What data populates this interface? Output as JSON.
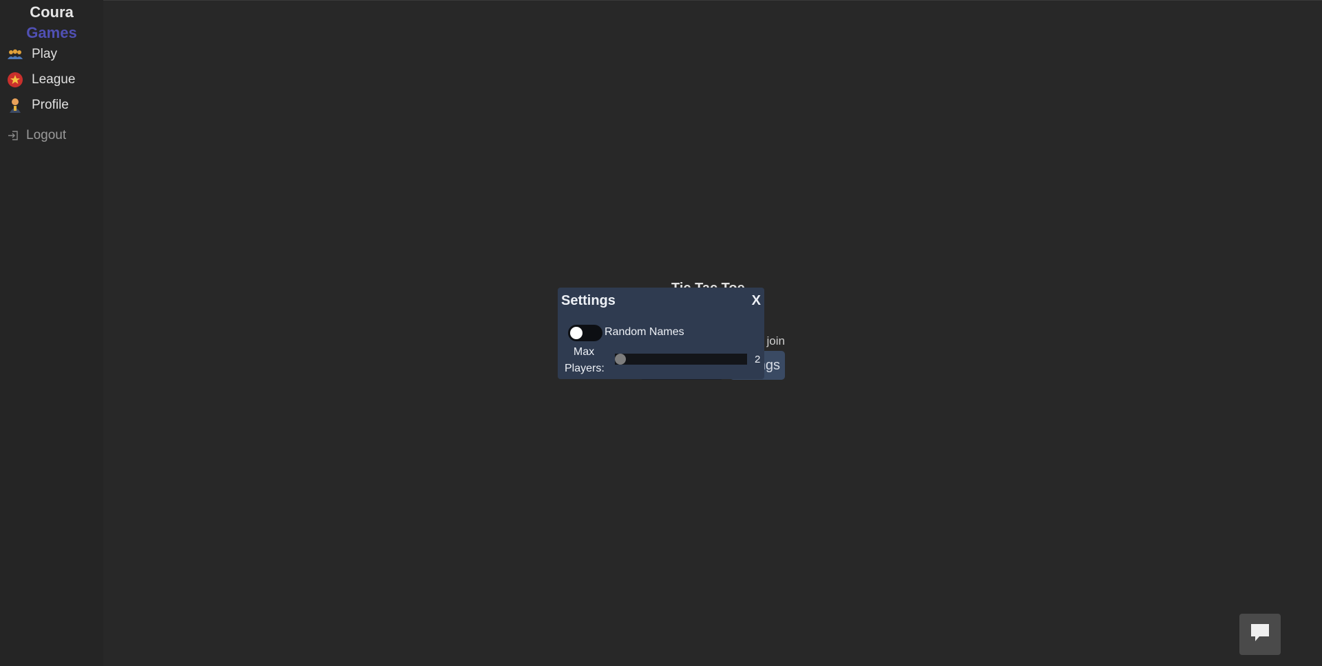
{
  "brand": {
    "line1": "Coura",
    "line2": "Games"
  },
  "nav": {
    "play": {
      "label": "Play",
      "icon": "people-icon"
    },
    "league": {
      "label": "League",
      "icon": "star-badge-icon"
    },
    "profile": {
      "label": "Profile",
      "icon": "person-icon"
    },
    "logout": {
      "label": "Logout",
      "icon": "logout-icon"
    }
  },
  "lobby": {
    "title": "Tic Tac Toe",
    "status": "Waiting to join...",
    "settings_button": "Settings"
  },
  "modal": {
    "title": "Settings",
    "close": "X",
    "random_names_label": "Random Names",
    "random_names_on": false,
    "max_players_label": "Max Players:",
    "max_players_value": "2"
  },
  "chat": {
    "icon": "chat-bubble-icon"
  },
  "colors": {
    "background": "#282828",
    "brand_accent": "#5050b4",
    "modal_bg": "#2f3b50"
  }
}
